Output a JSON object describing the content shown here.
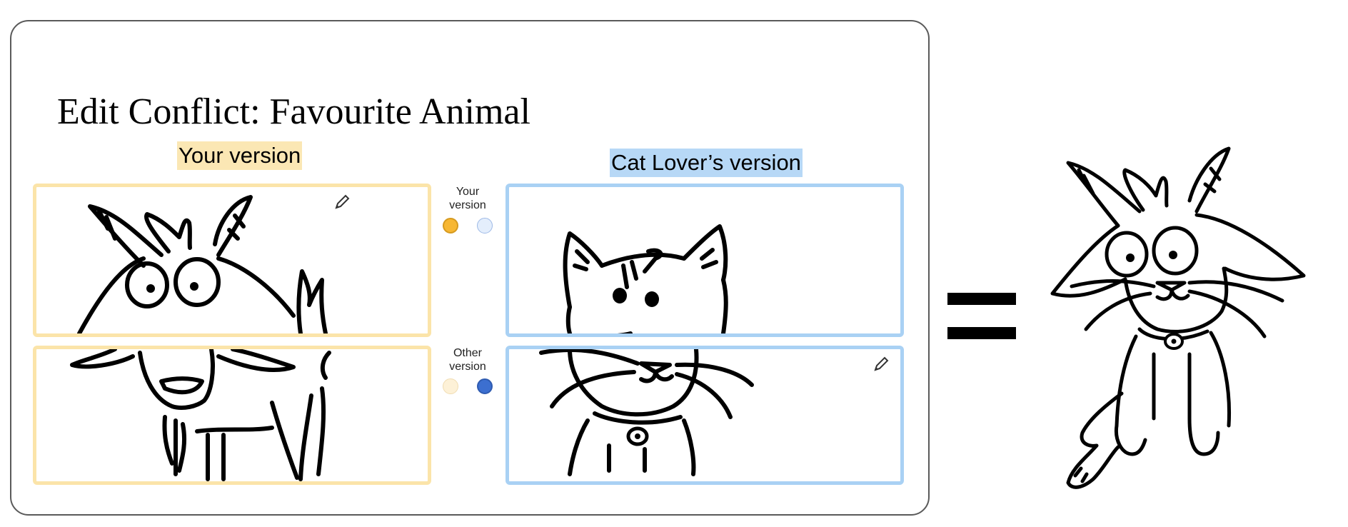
{
  "dialog": {
    "title": "Edit Conflict: Favourite Animal",
    "your_version_label": "Your version",
    "other_version_label": "Cat Lover’s version"
  },
  "merge_controls": {
    "top_caption": "Your\nversion",
    "bottom_caption": "Other\nversion",
    "top_selected": "yours",
    "bottom_selected": "other"
  },
  "icons": {
    "edit": "pencil-icon",
    "equals": "equals-sign"
  },
  "colors": {
    "yours_accent": "#fbe4a9",
    "yours_selected": "#f7b733",
    "other_accent": "#a9d1f4",
    "other_selected": "#3c6fd0",
    "dialog_border": "#5a5a5a"
  },
  "panels": {
    "yours_top": "goat-head",
    "yours_bottom": "goat-body",
    "other_top": "cat-head",
    "other_bottom": "cat-body",
    "result": "goat-head-on-cat-body"
  }
}
